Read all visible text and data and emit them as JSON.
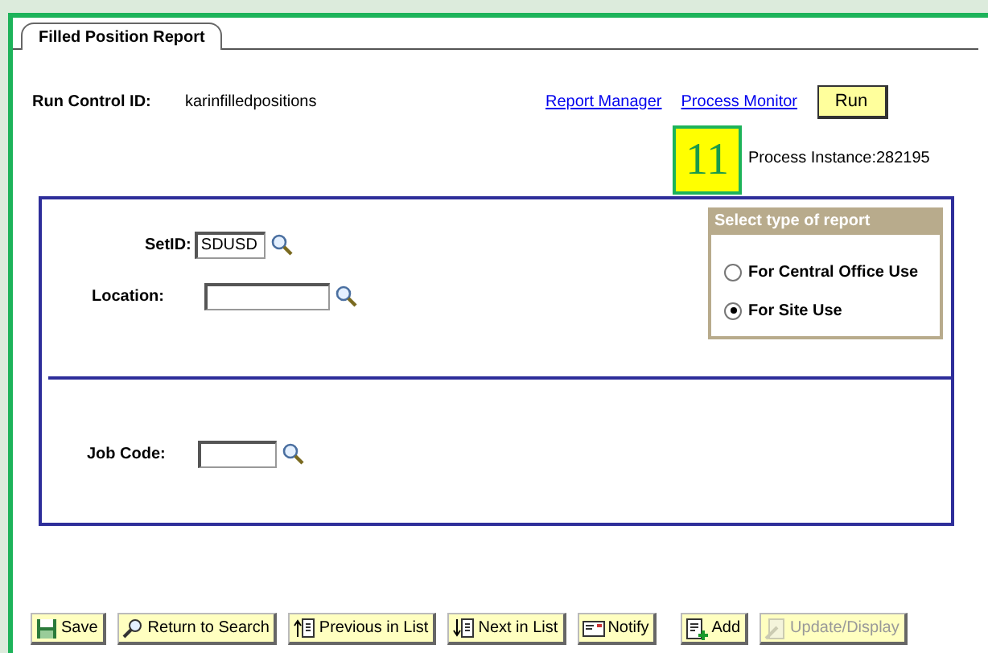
{
  "tab": {
    "label": "Filled Position Report",
    "selected": true
  },
  "run_control": {
    "label": "Run Control ID:",
    "value": "karinfilledpositions"
  },
  "links": [
    "Report Manager",
    "Process Monitor"
  ],
  "run_button": "Run",
  "callout": "11",
  "process_instance": "Process Instance:282195",
  "fields": [
    {
      "label": "SetID:",
      "value": "SDUSD"
    },
    {
      "label": "Location:"
    }
  ],
  "job_code": {
    "label": "Job Code:"
  },
  "report_type": {
    "title": "Select type of report",
    "options": [
      {
        "label": "For Central Office Use",
        "selected": false
      },
      {
        "label": "For Site Use",
        "selected": true
      }
    ]
  },
  "toolbar": [
    {
      "label": "Save",
      "kind": "save",
      "disabled": false
    },
    {
      "label": "Return to Search",
      "kind": "search",
      "disabled": false
    },
    {
      "label": "Previous in List",
      "kind": "previous",
      "disabled": false
    },
    {
      "label": "Next in List",
      "kind": "next",
      "disabled": false
    },
    {
      "label": "Notify",
      "kind": "notify",
      "disabled": false
    },
    {
      "label": "Add",
      "kind": "add",
      "disabled": false
    },
    {
      "label": "Update/Display",
      "kind": "update",
      "disabled": true
    }
  ]
}
